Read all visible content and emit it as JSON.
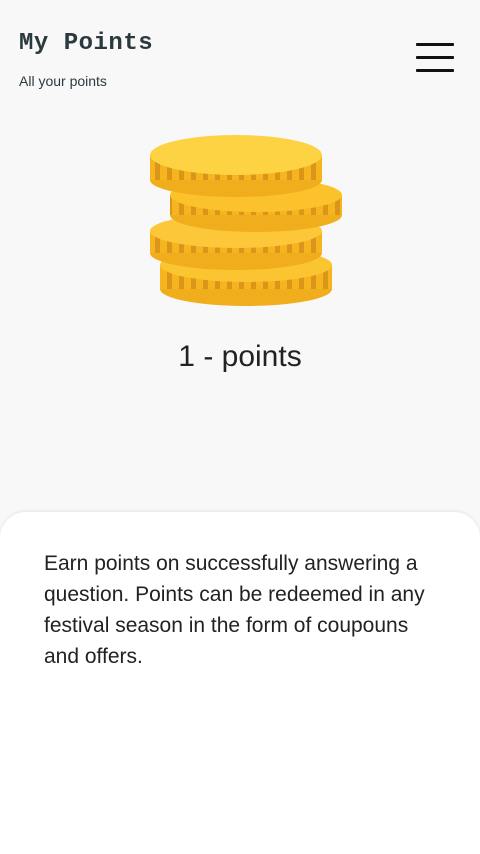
{
  "header": {
    "title": "My Points",
    "subtitle": "All your points"
  },
  "menu": {
    "icon": "hamburger-menu-icon"
  },
  "points": {
    "text": "1 - points",
    "icon": "coin-stack-icon",
    "coin_color": "#fbc02d"
  },
  "info": {
    "text": "Earn points on successfully answering a question. Points can be redeemed in any festival season in the form of coupouns and offers."
  }
}
